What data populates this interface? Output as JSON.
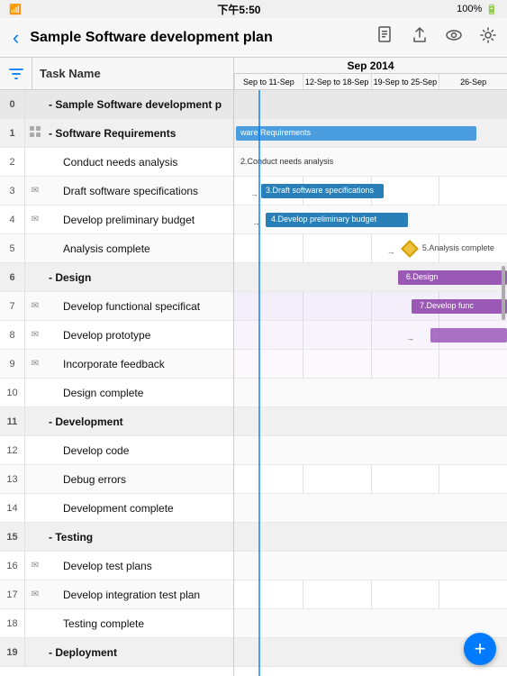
{
  "statusBar": {
    "leftIcons": "🔋📶",
    "time": "下午5:50",
    "rightText": "100%"
  },
  "titleBar": {
    "backLabel": "‹",
    "title": "Sample Software development plan",
    "icons": [
      "doc",
      "share",
      "eye",
      "gear"
    ]
  },
  "toolbar": {
    "filterIcon": "funnel",
    "columnHeader": "Task Name",
    "ganttMonth": "Sep 2014",
    "weeks": [
      "Sep to 11-Sep",
      "12-Sep to 18-Sep",
      "19-Sep to 25-Sep",
      "26-Sep"
    ]
  },
  "tasks": [
    {
      "id": "0",
      "indent": 0,
      "type": "top-group",
      "icon": "",
      "name": "- Sample Software development p"
    },
    {
      "id": "1",
      "indent": 0,
      "type": "group",
      "icon": "grid",
      "name": "- Software Requirements"
    },
    {
      "id": "2",
      "indent": 1,
      "type": "task",
      "icon": "",
      "name": "Conduct needs analysis"
    },
    {
      "id": "3",
      "indent": 1,
      "type": "task",
      "icon": "msg",
      "name": "Draft software specifications"
    },
    {
      "id": "4",
      "indent": 1,
      "type": "task",
      "icon": "msg",
      "name": "Develop preliminary budget"
    },
    {
      "id": "5",
      "indent": 1,
      "type": "milestone",
      "icon": "",
      "name": "Analysis complete"
    },
    {
      "id": "6",
      "indent": 0,
      "type": "group",
      "icon": "",
      "name": "- Design"
    },
    {
      "id": "7",
      "indent": 1,
      "type": "task",
      "icon": "msg",
      "name": "Develop functional specificat"
    },
    {
      "id": "8",
      "indent": 1,
      "type": "task",
      "icon": "msg",
      "name": "Develop prototype"
    },
    {
      "id": "9",
      "indent": 1,
      "type": "task",
      "icon": "msg",
      "name": "Incorporate feedback"
    },
    {
      "id": "10",
      "indent": 1,
      "type": "milestone",
      "icon": "",
      "name": "Design complete"
    },
    {
      "id": "11",
      "indent": 0,
      "type": "group",
      "icon": "",
      "name": "- Development"
    },
    {
      "id": "12",
      "indent": 1,
      "type": "task",
      "icon": "",
      "name": "Develop code"
    },
    {
      "id": "13",
      "indent": 1,
      "type": "task",
      "icon": "",
      "name": "Debug errors"
    },
    {
      "id": "14",
      "indent": 1,
      "type": "milestone",
      "icon": "",
      "name": "Development complete"
    },
    {
      "id": "15",
      "indent": 0,
      "type": "group",
      "icon": "",
      "name": "- Testing"
    },
    {
      "id": "16",
      "indent": 1,
      "type": "task",
      "icon": "msg",
      "name": "Develop test plans"
    },
    {
      "id": "17",
      "indent": 1,
      "type": "task",
      "icon": "msg",
      "name": "Develop integration test plan"
    },
    {
      "id": "18",
      "indent": 1,
      "type": "milestone",
      "icon": "",
      "name": "Testing complete"
    },
    {
      "id": "19",
      "indent": 0,
      "type": "group",
      "icon": "",
      "name": "- Deployment"
    }
  ],
  "colors": {
    "blue": "#4da6ff",
    "purple": "#9b59b6",
    "blueDark": "#2980b9",
    "milestone": "#f39c12",
    "accent": "#007aff"
  }
}
